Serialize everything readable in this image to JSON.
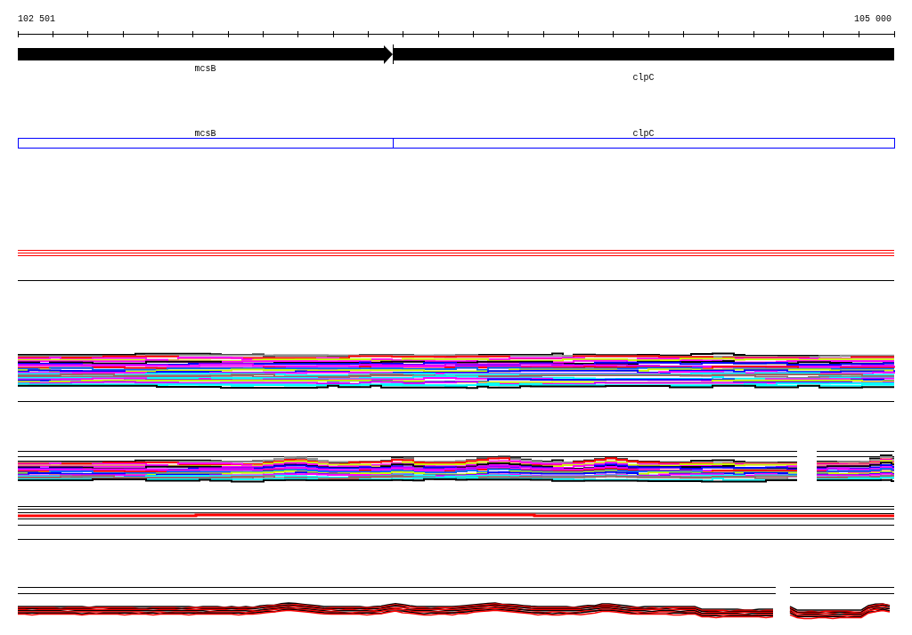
{
  "ruler": {
    "start_label": "102 501",
    "end_label": "105 000"
  },
  "genes": [
    {
      "label": "mcsB"
    },
    {
      "label": "clpC"
    }
  ],
  "annotations": [
    {
      "label": "mcsB"
    },
    {
      "label": "clpC"
    }
  ]
}
